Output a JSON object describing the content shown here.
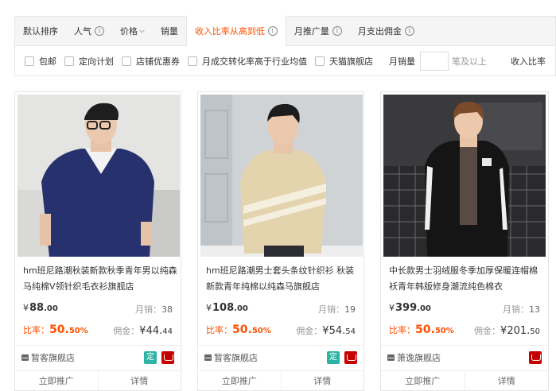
{
  "sortbar": {
    "default": "默认排序",
    "popularity": "人气",
    "price": "价格",
    "sales": "销量",
    "income_ratio": "收入比率从高到低",
    "monthly_promo": "月推广量",
    "monthly_commission": "月支出佣金",
    "info_glyph": "i"
  },
  "filters": {
    "baoyou": "包邮",
    "directed_plan": "定向计划",
    "shop_coupon": "店铺优惠券",
    "conversion": "月成交转化率高于行业均值",
    "tmall": "天猫旗舰店",
    "monthly_sales_label": "月销量",
    "monthly_sales_suffix": "笔及以上",
    "income_ratio_label": "收入比率"
  },
  "products": [
    {
      "title": "hm班尼路潮秋装新款秋季青年男以纯森马纯棉V领针织毛衣衫旗舰店",
      "price_int": "88",
      "price_dec": ".00",
      "sales_label": "月销：",
      "sales": "38",
      "ratio_label": "比率：",
      "ratio_int": "50.",
      "ratio_dec": "50%",
      "comm_label": "佣金：",
      "comm_int": "44.",
      "comm_dec": "44",
      "shop": "暂客旗舰店",
      "has_ding": true
    },
    {
      "title": "hm班尼路潮男士套头条纹针织衫 秋装新款青年纯棉以纯森马旗舰店",
      "price_int": "108",
      "price_dec": ".00",
      "sales_label": "月销：",
      "sales": "19",
      "ratio_label": "比率：",
      "ratio_int": "50.",
      "ratio_dec": "50%",
      "comm_label": "佣金：",
      "comm_int": "54.",
      "comm_dec": "54",
      "shop": "暂客旗舰店",
      "has_ding": true
    },
    {
      "title": "中长款男士羽绒服冬季加厚保暖连帽棉袄青年韩版修身潮流纯色棉衣",
      "price_int": "399",
      "price_dec": ".00",
      "sales_label": "月销：",
      "sales": "13",
      "ratio_label": "比率：",
      "ratio_int": "50.",
      "ratio_dec": "50%",
      "comm_label": "佣金：",
      "comm_int": "201.",
      "comm_dec": "50",
      "shop": "萧逸旗舰店",
      "has_ding": false
    }
  ],
  "currency": "¥",
  "badge_ding": "定",
  "actions": {
    "promote": "立即推广",
    "detail": "详情"
  },
  "colors": {
    "accent": "#ff5000",
    "ding": "#2bb3a3",
    "tmall": "#c40000"
  }
}
